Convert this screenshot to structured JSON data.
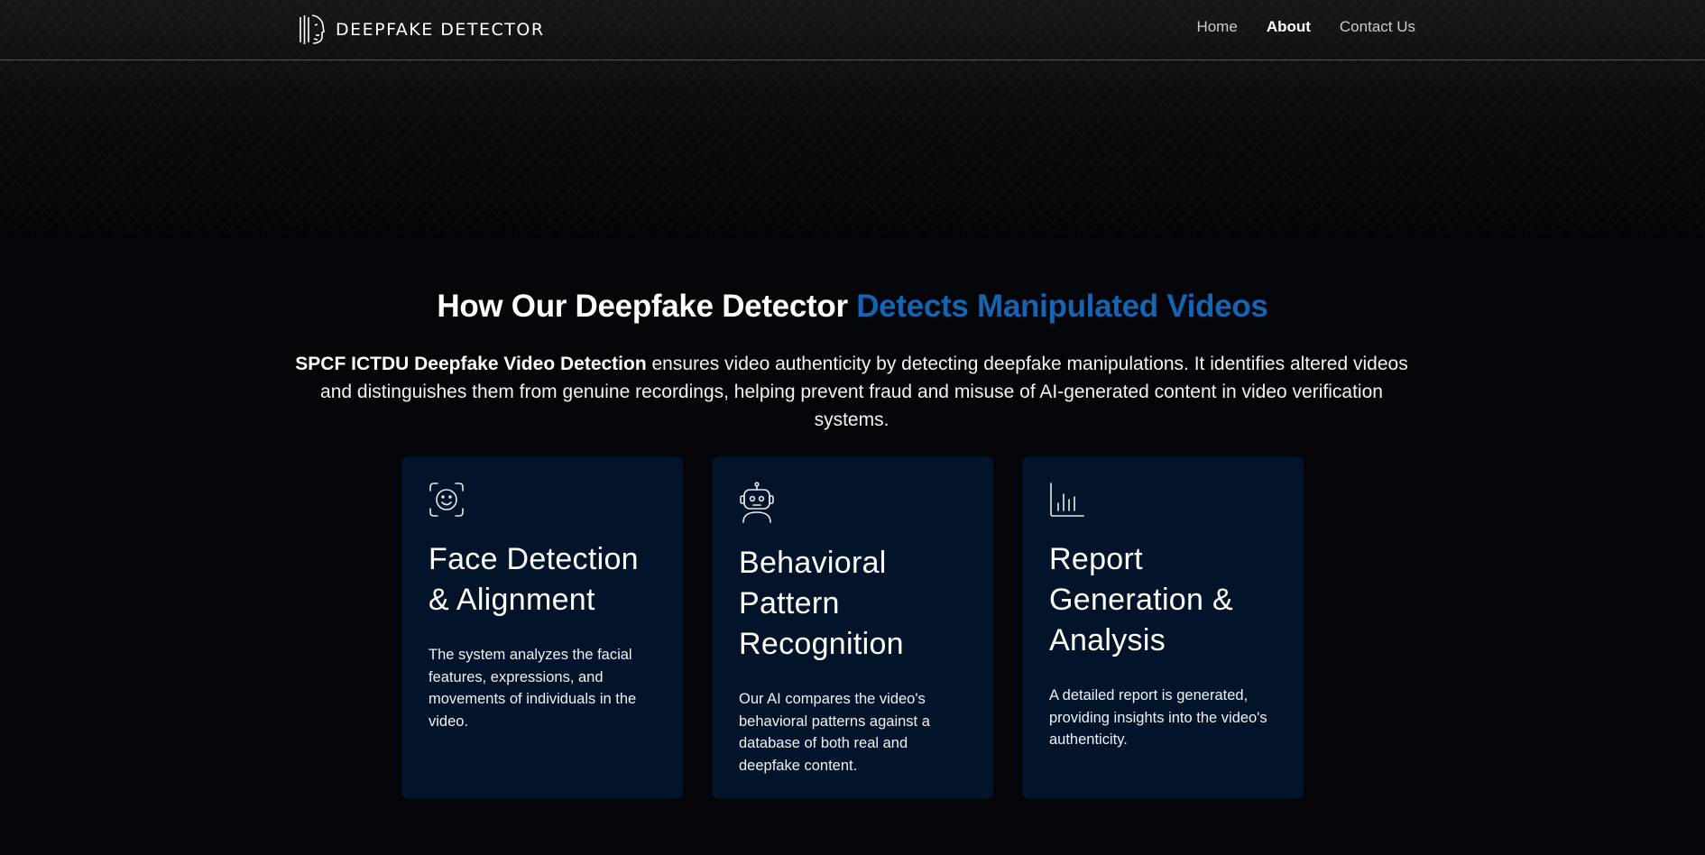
{
  "header": {
    "brand": "DEEPFAKE DETECTOR",
    "nav": [
      {
        "label": "Home",
        "active": false
      },
      {
        "label": "About",
        "active": true
      },
      {
        "label": "Contact Us",
        "active": false
      }
    ]
  },
  "main": {
    "title_plain": "How Our Deepfake Detector ",
    "title_accent": "Detects Manipulated Videos",
    "description_bold": "SPCF ICTDU Deepfake Video Detection",
    "description_rest": " ensures video authenticity by detecting deepfake manipulations. It identifies altered videos and distinguishes them from genuine recordings, helping prevent fraud and misuse of AI-generated content in video verification systems.",
    "cards": [
      {
        "icon": "face-scan-icon",
        "title": "Face Detection & Alignment",
        "text": "The system analyzes the facial features, expressions, and movements of individuals in the video."
      },
      {
        "icon": "robot-icon",
        "title": "Behavioral Pattern Recognition",
        "text": "Our AI compares the video's behavioral patterns against a database of both real and deepfake content."
      },
      {
        "icon": "bar-chart-icon",
        "title": "Report Generation & Analysis",
        "text": "A detailed report is generated, providing insights into the video's authenticity."
      }
    ]
  },
  "colors": {
    "accent": "#1664b4",
    "card_background": "#03142a",
    "page_background": "#030508"
  }
}
